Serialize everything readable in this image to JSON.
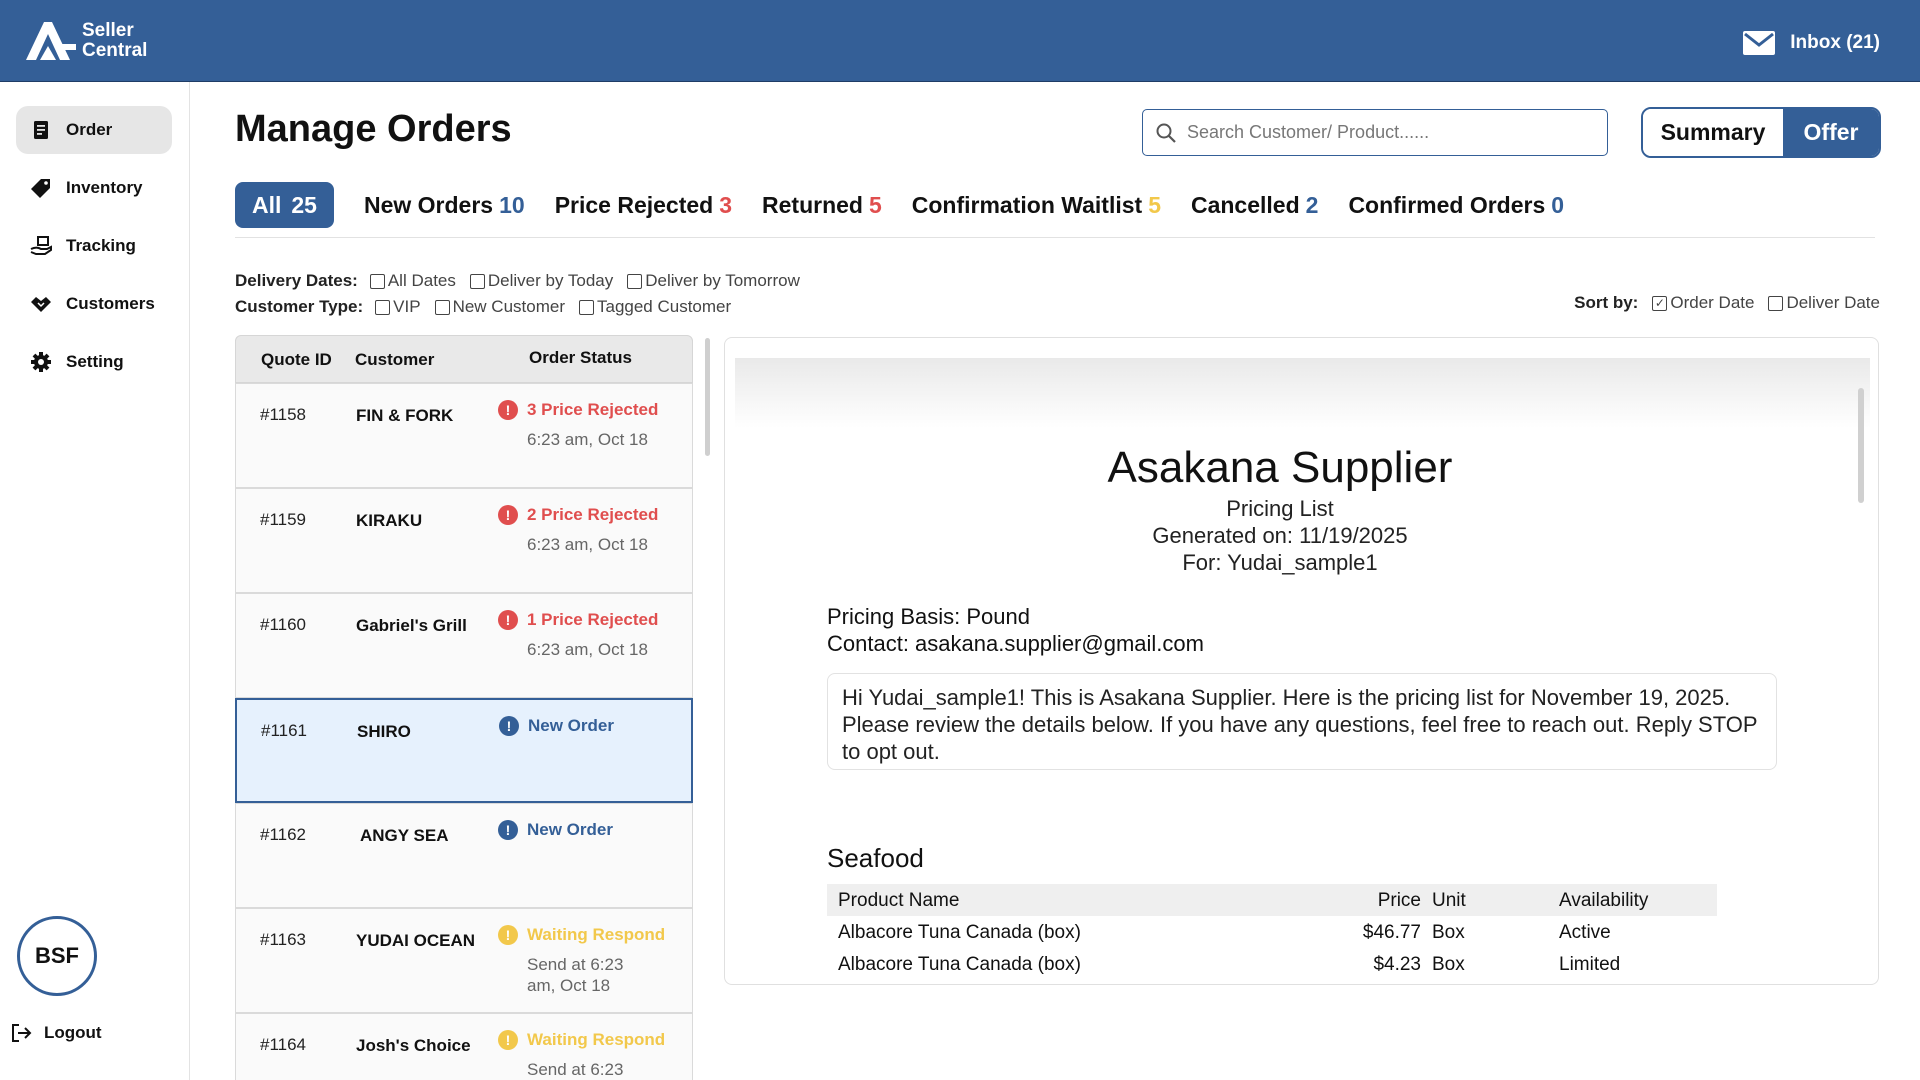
{
  "brand": {
    "line1": "Seller",
    "line2": "Central"
  },
  "inbox": {
    "label": "Inbox (21)"
  },
  "sidebar": {
    "items": [
      {
        "label": "Order",
        "icon": "document-icon",
        "active": true
      },
      {
        "label": "Inventory",
        "icon": "tag-icon"
      },
      {
        "label": "Tracking",
        "icon": "delivery-icon"
      },
      {
        "label": "Customers",
        "icon": "handshake-icon"
      },
      {
        "label": "Setting",
        "icon": "gear-icon"
      }
    ],
    "avatar": "BSF",
    "logout": "Logout"
  },
  "header": {
    "title": "Manage Orders",
    "search_placeholder": "Search Customer/ Product......",
    "view_toggle": {
      "summary": "Summary",
      "offer": "Offer",
      "selected": "Offer"
    }
  },
  "tabs": [
    {
      "label": "All",
      "count": "25",
      "active": true
    },
    {
      "label": "New Orders",
      "count": "10",
      "color": "#345f97"
    },
    {
      "label": "Price Rejected",
      "count": "3",
      "color": "#e04e4e"
    },
    {
      "label": "Returned",
      "count": "5",
      "color": "#e04e4e"
    },
    {
      "label": "Confirmation Waitlist",
      "count": "5",
      "color": "#f2c84b"
    },
    {
      "label": "Cancelled",
      "count": "2",
      "color": "#345f97"
    },
    {
      "label": "Confirmed Orders",
      "count": "0",
      "color": "#345f97"
    }
  ],
  "filters": {
    "delivery_label": "Delivery Dates:",
    "delivery_options": [
      "All Dates",
      "Deliver by Today",
      "Deliver by Tomorrow"
    ],
    "customer_label": "Customer Type:",
    "customer_options": [
      "VIP",
      "New Customer",
      "Tagged Customer"
    ],
    "sort_label": "Sort by:",
    "sort_options": [
      {
        "label": "Order Date",
        "checked": true
      },
      {
        "label": "Deliver Date",
        "checked": false
      }
    ]
  },
  "orders": {
    "headers": {
      "quote_id": "Quote ID",
      "customer": "Customer",
      "status": "Order Status"
    },
    "rows": [
      {
        "id": "#1158",
        "customer": "FIN & FORK",
        "status": "3 Price Rejected",
        "time": "6:23 am, Oct 18",
        "kind": "rejected"
      },
      {
        "id": "#1159",
        "customer": "KIRAKU",
        "status": "2 Price Rejected",
        "time": "6:23 am, Oct 18",
        "kind": "rejected"
      },
      {
        "id": "#1160",
        "customer": "Gabriel's Grill",
        "status": "1 Price Rejected",
        "time": "6:23 am, Oct 18",
        "kind": "rejected"
      },
      {
        "id": "#1161",
        "customer": "SHIRO",
        "status": "New Order",
        "time": "",
        "kind": "new",
        "selected": true
      },
      {
        "id": "#1162",
        "customer": "ANGY SEA",
        "status": "New Order",
        "time": "",
        "kind": "new"
      },
      {
        "id": "#1163",
        "customer": "YUDAI OCEAN",
        "status": "Waiting Respond",
        "time": "Send at 6:23 am, Oct 18",
        "kind": "waiting"
      },
      {
        "id": "#1164",
        "customer": "Josh's Choice",
        "status": "Waiting Respond",
        "time": "Send at 6:23",
        "kind": "waiting"
      }
    ]
  },
  "preview": {
    "title": "Asakana Supplier",
    "subtitle": "Pricing List",
    "generated": "Generated on: 11/19/2025",
    "for": "For: Yudai_sample1",
    "basis": "Pricing Basis: Pound",
    "contact": "Contact: asakana.supplier@gmail.com",
    "message": "Hi Yudai_sample1! This is Asakana Supplier. Here is the pricing list for November 19, 2025. Please review the details below. If you have any questions, feel free to reach out. Reply STOP to opt out.",
    "section": "Seafood",
    "table": {
      "headers": {
        "name": "Product Name",
        "price": "Price",
        "unit": "Unit",
        "availability": "Availability"
      },
      "rows": [
        {
          "name": "Albacore Tuna Canada (box)",
          "price": "$46.77",
          "unit": "Box",
          "availability": "Active"
        },
        {
          "name": "Albacore Tuna Canada (box)",
          "price": "$4.23",
          "unit": "Box",
          "availability": "Limited"
        }
      ]
    }
  }
}
